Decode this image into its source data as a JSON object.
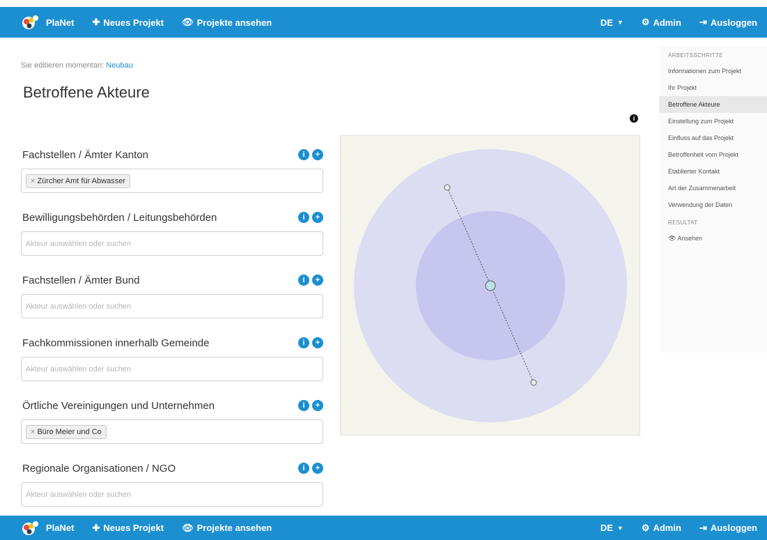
{
  "navbar": {
    "brand": "PlaNet",
    "new_project": "Neues Projekt",
    "view_projects": "Projekte ansehen",
    "language": "DE",
    "admin": "Admin",
    "logout": "Ausloggen"
  },
  "main": {
    "editing_prefix": "Sie editieren momentan:",
    "editing_project": "Neubau",
    "title": "Betroffene Akteure"
  },
  "groups": [
    {
      "label": "Fachstellen / Ämter Kanton",
      "tags": [
        "Zürcher Amt für Abwasser"
      ],
      "placeholder": ""
    },
    {
      "label": "Bewilligungsbehörden / Leitungsbehörden",
      "tags": [],
      "placeholder": "Akteur auswählen oder suchen"
    },
    {
      "label": "Fachstellen / Ämter Bund",
      "tags": [],
      "placeholder": "Akteur auswählen oder suchen"
    },
    {
      "label": "Fachkommissionen innerhalb Gemeinde",
      "tags": [],
      "placeholder": "Akteur auswählen oder suchen"
    },
    {
      "label": "Örtliche Vereinigungen und Unternehmen",
      "tags": [
        "Büro Meier und Co"
      ],
      "placeholder": ""
    },
    {
      "label": "Regionale Organisationen / NGO",
      "tags": [],
      "placeholder": "Akteur auswählen oder suchen"
    }
  ],
  "sidebar": {
    "heading": "ARBEITSSCHRITTE",
    "items": [
      "Informationen zum Projekt",
      "Ihr Projekt",
      "Betroffene Akteure",
      "Einstellung zum Projekt",
      "Einfluss auf das Projekt",
      "Betroffenheit vom Projekt",
      "Etablierter Kontakt",
      "Art der Zusammenarbeit",
      "Verwendung der Daten"
    ],
    "active_index": 2,
    "result_heading": "RESULTAT",
    "view_label": "Ansehen"
  },
  "colors": {
    "navbar": "#1c8fd0",
    "outer_circle": "#dcdcf2",
    "inner_circle": "#c6c6ee",
    "center_node": "#bfe0ea",
    "panel": "#f5f4ec"
  },
  "icons": {
    "plus": "plus-icon",
    "eye": "eye-icon",
    "gear": "gear-icon",
    "logout": "logout-icon",
    "info": "info-icon",
    "add": "add-circle-icon"
  }
}
